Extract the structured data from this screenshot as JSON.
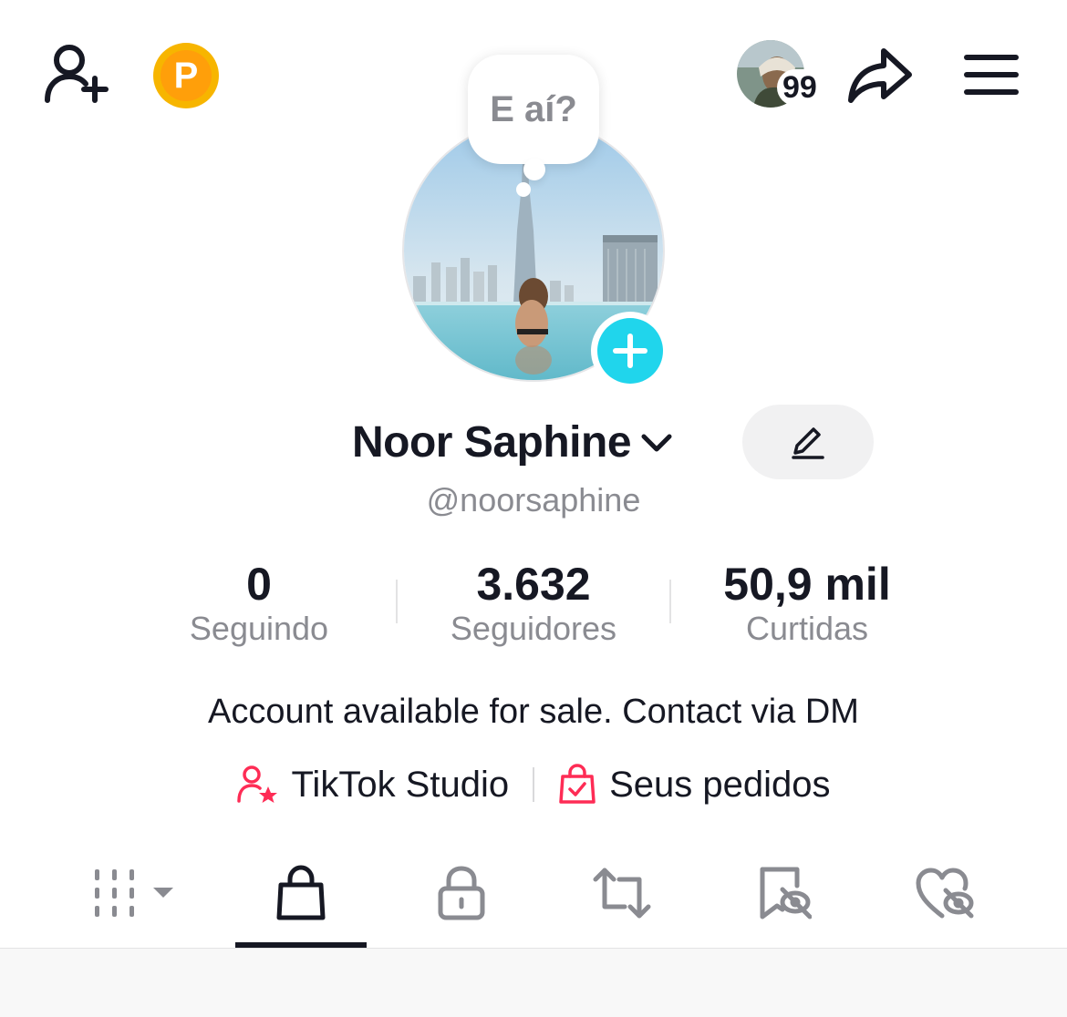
{
  "header": {
    "add_friend_icon": "person-plus-icon",
    "coin_letter": "P",
    "notification_count": "99",
    "share_icon": "share-arrow-icon",
    "menu_icon": "hamburger-menu-icon"
  },
  "profile": {
    "bubble_text": "E aí?",
    "display_name": "Noor Saphine",
    "username": "@noorsaphine",
    "bio": "Account available for sale. Contact via DM"
  },
  "stats": [
    {
      "value": "0",
      "label": "Seguindo"
    },
    {
      "value": "3.632",
      "label": "Seguidores"
    },
    {
      "value": "50,9 mil",
      "label": "Curtidas"
    }
  ],
  "links": {
    "studio": "TikTok Studio",
    "orders": "Seus pedidos"
  },
  "tabs": [
    {
      "icon": "grid-icon",
      "active": false
    },
    {
      "icon": "shopping-bag-icon",
      "active": true
    },
    {
      "icon": "lock-icon",
      "active": false
    },
    {
      "icon": "repost-icon",
      "active": false
    },
    {
      "icon": "saved-hidden-icon",
      "active": false
    },
    {
      "icon": "liked-hidden-icon",
      "active": false
    }
  ],
  "colors": {
    "accent_cyan": "#20d5ec",
    "accent_pink": "#fe2c55",
    "coin_gold": "#f7b500",
    "text_primary": "#161823",
    "text_secondary": "#8a8b91"
  }
}
